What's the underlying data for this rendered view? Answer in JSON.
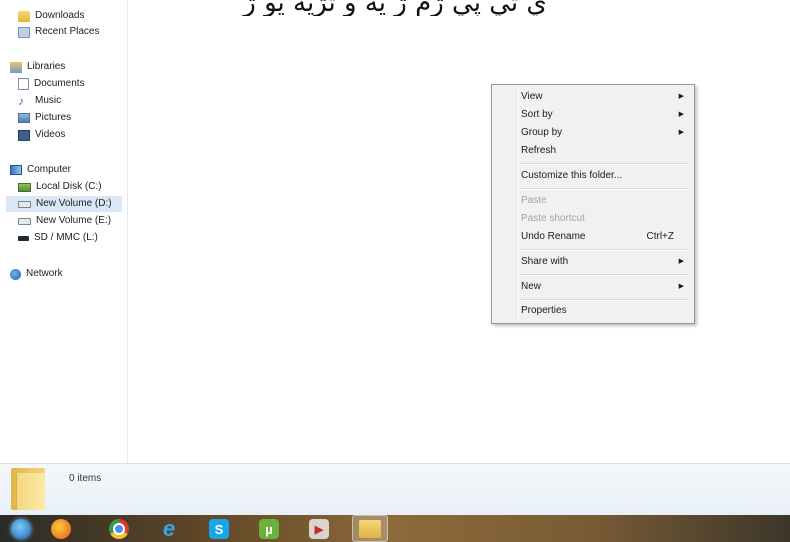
{
  "overlay_caption": "ي تي پي ڙم ڙ يه و ٿڙيه يو ڙ",
  "sidebar": {
    "items": [
      {
        "label": "Downloads",
        "icon": "downloads-folder-icon"
      },
      {
        "label": "Recent Places",
        "icon": "recent-places-icon"
      },
      {
        "label": "Libraries",
        "icon": "libraries-icon"
      },
      {
        "label": "Documents",
        "icon": "documents-icon"
      },
      {
        "label": "Music",
        "icon": "music-icon"
      },
      {
        "label": "Pictures",
        "icon": "pictures-icon"
      },
      {
        "label": "Videos",
        "icon": "videos-icon"
      },
      {
        "label": "Computer",
        "icon": "computer-icon"
      },
      {
        "label": "Local Disk (C:)",
        "icon": "local-disk-icon"
      },
      {
        "label": "New Volume (D:)",
        "icon": "drive-icon",
        "selected": true
      },
      {
        "label": "New Volume (E:)",
        "icon": "drive-icon"
      },
      {
        "label": "SD / MMC (L:)",
        "icon": "sd-card-icon"
      },
      {
        "label": "Network",
        "icon": "network-icon"
      }
    ]
  },
  "context_menu": {
    "items": [
      {
        "label": "View",
        "submenu": true
      },
      {
        "label": "Sort by",
        "submenu": true
      },
      {
        "label": "Group by",
        "submenu": true
      },
      {
        "label": "Refresh"
      },
      {
        "label": "Customize this folder..."
      },
      {
        "label": "Paste",
        "disabled": true
      },
      {
        "label": "Paste shortcut",
        "disabled": true
      },
      {
        "label": "Undo Rename",
        "shortcut": "Ctrl+Z"
      },
      {
        "label": "Share with",
        "submenu": true
      },
      {
        "label": "New",
        "submenu": true
      },
      {
        "label": "Properties"
      }
    ]
  },
  "status_bar": {
    "item_count": "0 items"
  },
  "taskbar": {
    "buttons": [
      {
        "name": "start-button",
        "icon": "windows-orb-icon"
      },
      {
        "name": "firefox-button",
        "icon": "firefox-icon"
      },
      {
        "name": "chrome-button",
        "icon": "chrome-icon"
      },
      {
        "name": "internet-explorer-button",
        "icon": "internet-explorer-icon",
        "glyph": "e"
      },
      {
        "name": "skype-button",
        "icon": "skype-icon",
        "glyph": "S"
      },
      {
        "name": "utorrent-button",
        "icon": "utorrent-icon",
        "glyph": "µ"
      },
      {
        "name": "media-player-button",
        "icon": "media-player-icon"
      },
      {
        "name": "windows-explorer-button",
        "icon": "windows-explorer-icon",
        "active": true
      }
    ]
  }
}
